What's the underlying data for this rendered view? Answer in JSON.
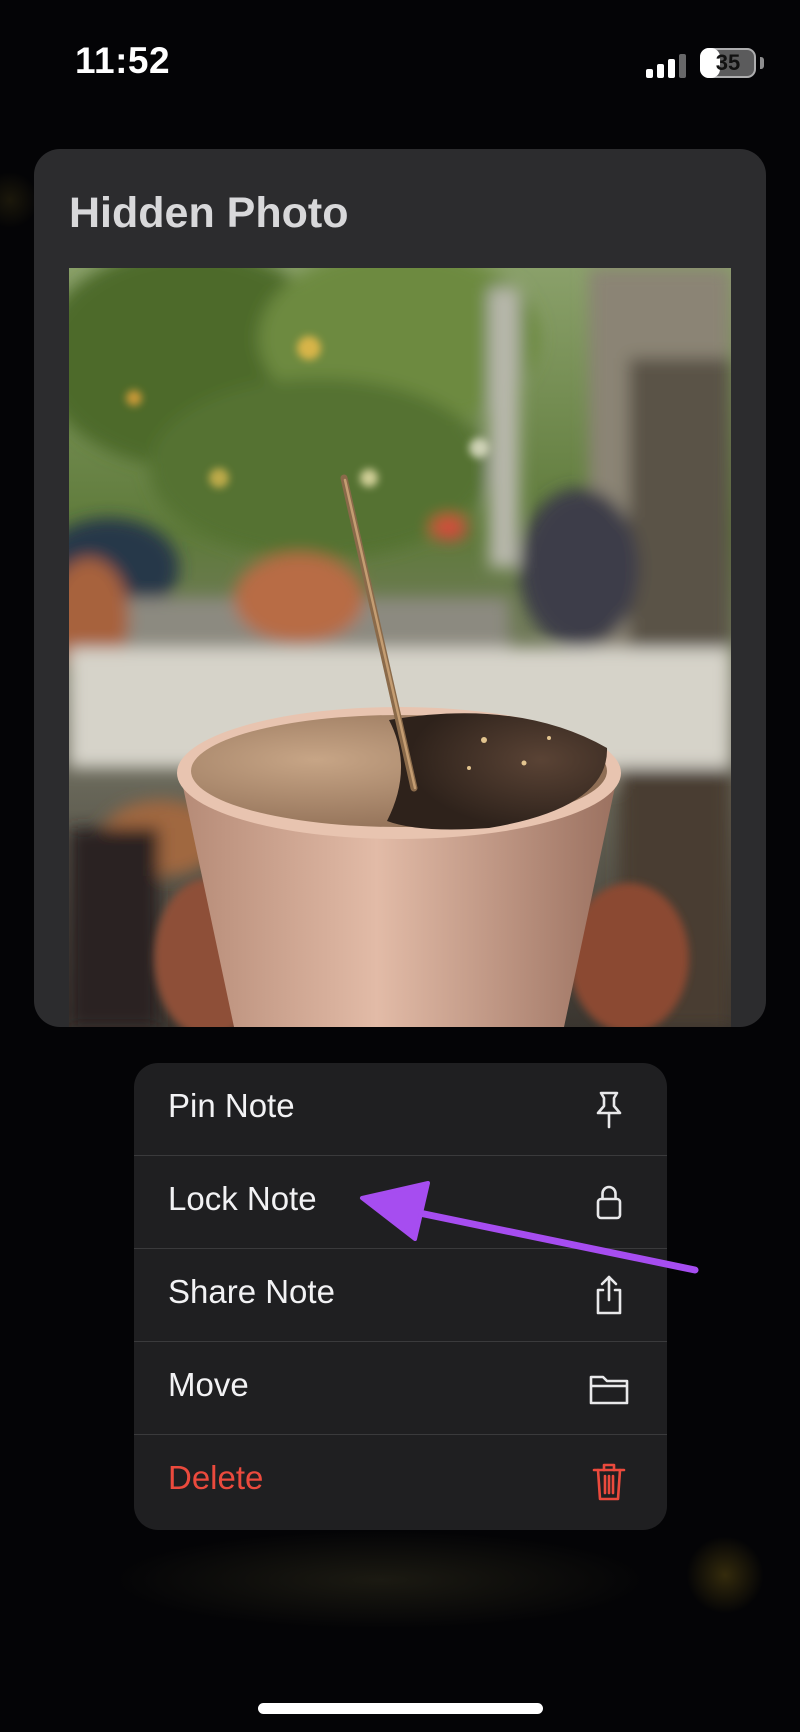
{
  "status_bar": {
    "time": "11:52",
    "battery_percent": "35",
    "battery_level": 0.35
  },
  "note": {
    "title": "Hidden Photo"
  },
  "context_menu": {
    "items": [
      {
        "label": "Pin Note",
        "icon": "pin-icon"
      },
      {
        "label": "Lock Note",
        "icon": "lock-icon"
      },
      {
        "label": "Share Note",
        "icon": "share-icon"
      },
      {
        "label": "Move",
        "icon": "folder-icon"
      },
      {
        "label": "Delete",
        "icon": "trash-icon",
        "destructive": true
      }
    ]
  },
  "colors": {
    "menu_background": "#1f1f21",
    "card_background": "#2c2c2e",
    "destructive": "#eb4a3d",
    "annotation_arrow": "#a64df0"
  }
}
